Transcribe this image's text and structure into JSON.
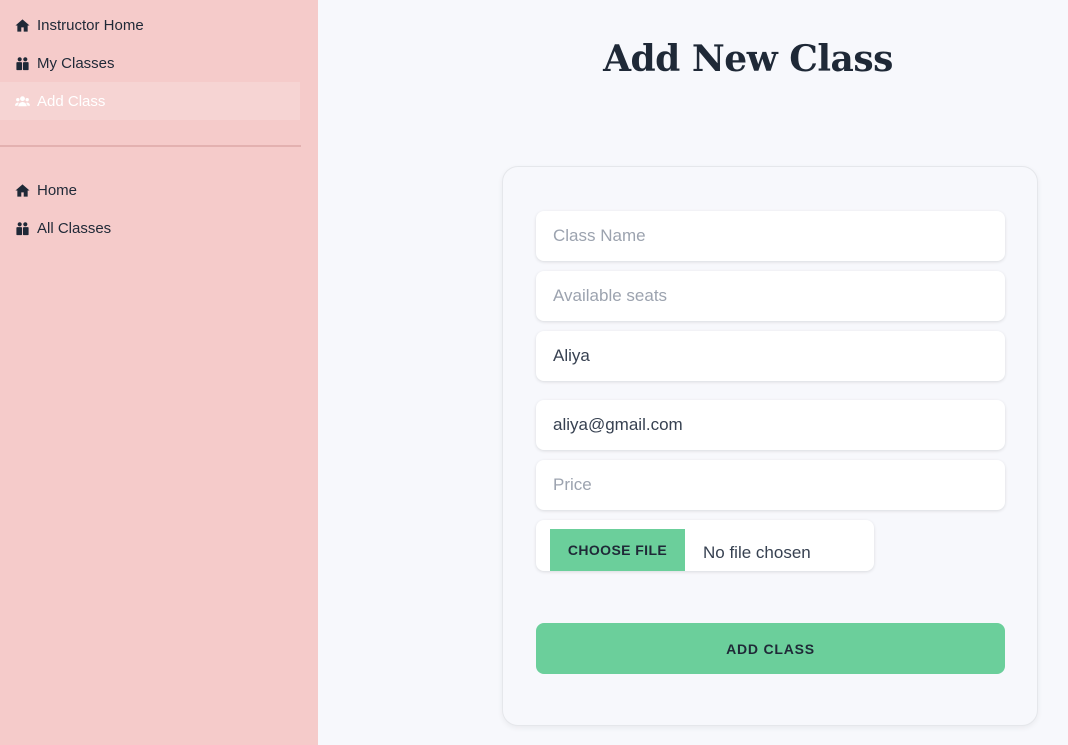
{
  "sidebar": {
    "primary": [
      {
        "label": "Instructor Home",
        "icon": "home-icon"
      },
      {
        "label": "My Classes",
        "icon": "users-box-icon"
      },
      {
        "label": "Add Class",
        "icon": "users-icon",
        "active": true
      }
    ],
    "secondary": [
      {
        "label": "Home",
        "icon": "home-icon"
      },
      {
        "label": "All Classes",
        "icon": "users-box-icon"
      }
    ]
  },
  "page": {
    "title": "Add New Class"
  },
  "form": {
    "class_name": {
      "value": "",
      "placeholder": "Class Name"
    },
    "available_seats": {
      "value": "",
      "placeholder": "Available seats"
    },
    "instructor_name": {
      "value": "Aliya",
      "placeholder": ""
    },
    "instructor_email": {
      "value": "aliya@gmail.com",
      "placeholder": ""
    },
    "price": {
      "value": "",
      "placeholder": "Price"
    },
    "file": {
      "button_label": "CHOOSE FILE",
      "status": "No file chosen"
    },
    "submit_label": "ADD CLASS"
  },
  "colors": {
    "sidebar_bg": "#f5cbca",
    "accent": "#6bcf9b",
    "page_bg": "#f7f8fc"
  }
}
